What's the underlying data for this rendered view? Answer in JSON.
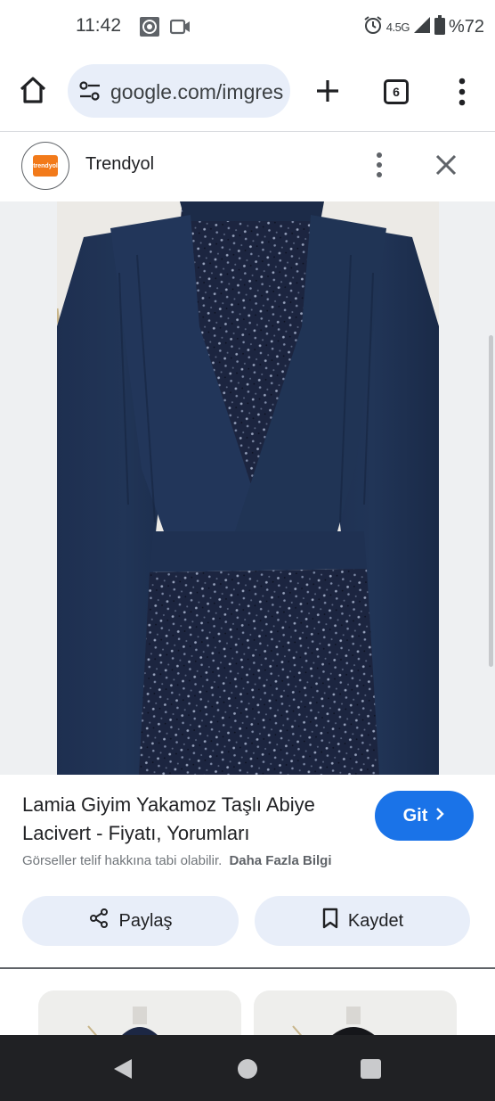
{
  "status_bar": {
    "time": "11:42",
    "network": "4.5G",
    "battery": "%72",
    "icons": [
      "chrome-notification-icon",
      "screen-record-icon",
      "alarm-icon",
      "signal-icon",
      "battery-icon"
    ]
  },
  "browser": {
    "url": "google.com/imgres",
    "tab_count": "6",
    "icons": [
      "home-icon",
      "site-settings-icon",
      "new-tab-icon",
      "tab-switcher-icon",
      "menu-icon"
    ]
  },
  "panel": {
    "source_logo_text": "trendyol",
    "source_name": "Trendyol",
    "icons": [
      "more-options-icon",
      "close-icon"
    ]
  },
  "product": {
    "title": "Lamia Giyim Yakamoz Taşlı Abiye Lacivert - Fiyatı, Yorumları",
    "visit_label": "Git",
    "copyright_text": "Görseller telif hakkına tabi olabilir.",
    "learn_more": "Daha Fazla Bilgi",
    "share_label": "Paylaş",
    "save_label": "Kaydet"
  },
  "colors": {
    "accent": "#1a73e8",
    "pill_bg": "#e8eef9",
    "dress_navy": "#1b2c4a",
    "brand_orange": "#f27a1a",
    "nav_bar": "#202124"
  }
}
